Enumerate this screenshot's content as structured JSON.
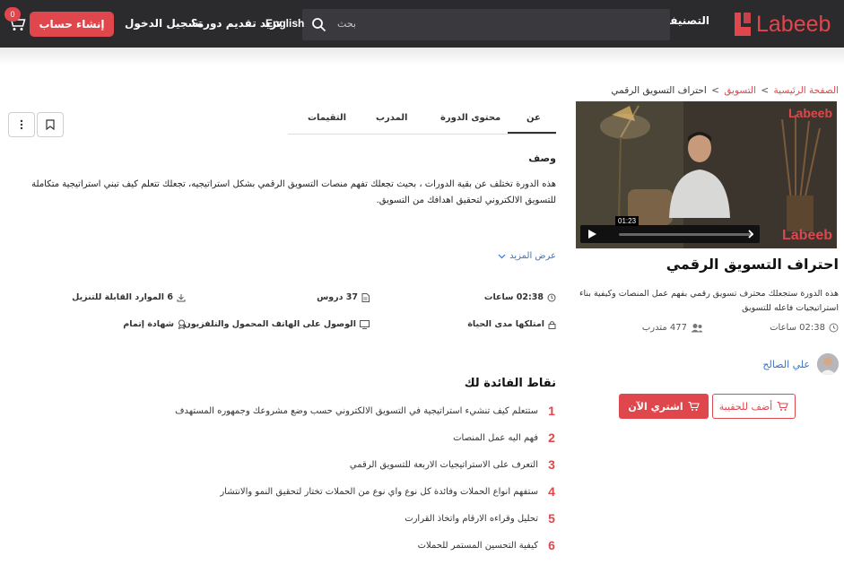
{
  "header": {
    "logo_text": "Labeeb",
    "categories_label": "التصنيفات",
    "search_placeholder": "بحث",
    "lang_label": "English",
    "teach_label": "تريد تقديم دورة؟",
    "login_label": "تسجيل الدخول",
    "signup_label": "إنشاء حساب",
    "cart_count": "0"
  },
  "breadcrumb": {
    "home": "الصفحة الرئيسية",
    "category": "التسويق",
    "current": "احتراف التسويق الرقمي"
  },
  "video": {
    "logo_text": "Labeeb",
    "time": "01:23"
  },
  "course": {
    "title": "احتراف التسويق الرقمي",
    "description": "هذه الدورة ستجعلك محترف تسويق رقمي بفهم عمل المنصات وكيفية بناء استراتيجيات فاعله للتسويق",
    "duration": "02:38 ساعات",
    "trainees": "477 متدرب",
    "instructor": "علي الصالح",
    "add_to_bag": "أضف للحقيبة",
    "buy_now": "اشتري الآن"
  },
  "tabs": [
    "عن",
    "محتوى الدورة",
    "المدرب",
    "التقيمات"
  ],
  "about": {
    "heading": "وصف",
    "text": "هذه الدورة تختلف عن بقية الدورات ، بحيث تجعلك تفهم منصات التسويق الرقمي بشكل استراتيجيه، تجعلك تتعلم كيف تبني استراتيجية متكاملة للتسويق الالكتروني لتحقيق اهدافك من التسويق.",
    "show_more": "عرض المزيد"
  },
  "features": {
    "hours": "02:38 ساعات",
    "lessons": "37 دروس",
    "resources": "6 الموارد القابلة للتنزيل",
    "lifetime": "امتلكها مدى الحياة",
    "devices": "الوصول على الهاتف المحمول والتلفزيون",
    "certificate": "شهادة إتمام"
  },
  "benefits": {
    "title": "نقاط الفائدة لك",
    "items": [
      {
        "num": "1",
        "text": "ستتعلم كيف تنشيء استراتيجية في التسويق الالكتروني حسب وضع مشروعك وجمهوره المستهدف"
      },
      {
        "num": "2",
        "text": "فهم اليه عمل المنصات"
      },
      {
        "num": "3",
        "text": "التعرف على الاستراتيجيات الاربعة للتسويق الرقمي"
      },
      {
        "num": "4",
        "text": "ستفهم انواع الحملات وفائدة كل نوع واي نوع من الحملات تختار لتحقيق النمو والانتشار"
      },
      {
        "num": "5",
        "text": "تحليل وقراءه الارقام واتخاذ القرارت"
      },
      {
        "num": "6",
        "text": "كيفية التحسين المستمر للحملات"
      }
    ]
  },
  "colors": {
    "accent": "#e0474c",
    "header_bg": "#2b2b2e",
    "link": "#3a73c9"
  }
}
